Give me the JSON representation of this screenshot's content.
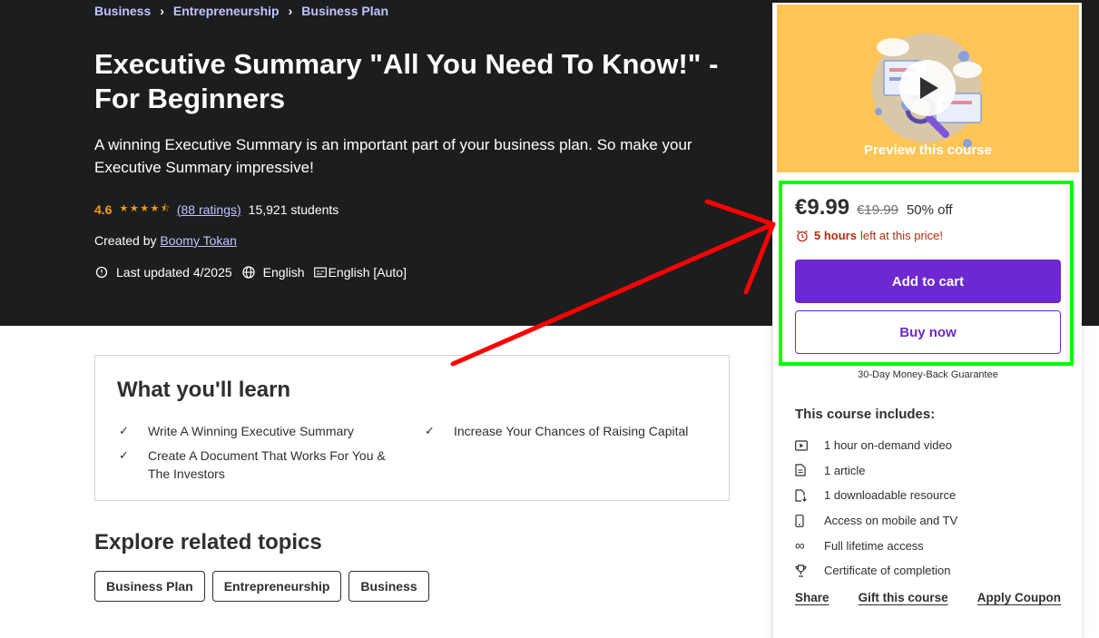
{
  "breadcrumb": [
    "Business",
    "Entrepreneurship",
    "Business Plan"
  ],
  "course": {
    "title": "Executive Summary \"All You Need To Know!\" - For Beginners",
    "subtitle": "A winning Executive Summary is an important part of your business plan. So make your Executive Summary impressive!",
    "rating": "4.6",
    "rating_value": 4.6,
    "ratings_count": "(88 ratings)",
    "students": "15,921 students",
    "created_by_label": "Created by",
    "instructor": "Boomy Tokan",
    "last_updated": "Last updated 4/2025",
    "language": "English",
    "captions": "English [Auto]"
  },
  "learn": {
    "title": "What you'll learn",
    "items": [
      "Write A Winning Executive Summary",
      "Increase Your Chances of Raising Capital",
      "Create A Document That Works For You & The Investors"
    ]
  },
  "related": {
    "title": "Explore related topics",
    "topics": [
      "Business Plan",
      "Entrepreneurship",
      "Business"
    ]
  },
  "card": {
    "preview_label": "Preview this course",
    "price": "€9.99",
    "old_price": "€19.99",
    "discount": "50% off",
    "timer_bold": "5 hours",
    "timer_rest": "left at this price!",
    "add_to_cart": "Add to cart",
    "buy_now": "Buy now",
    "guarantee": "30-Day Money-Back Guarantee",
    "includes_title": "This course includes:",
    "includes": [
      {
        "icon": "video-icon",
        "label": "1 hour on-demand video"
      },
      {
        "icon": "article-icon",
        "label": "1 article"
      },
      {
        "icon": "download-file-icon",
        "label": "1 downloadable resource"
      },
      {
        "icon": "mobile-icon",
        "label": "Access on mobile and TV"
      },
      {
        "icon": "infinity-icon",
        "label": "Full lifetime access"
      },
      {
        "icon": "trophy-icon",
        "label": "Certificate of completion"
      }
    ],
    "links": [
      "Share",
      "Gift this course",
      "Apply Coupon"
    ]
  },
  "colors": {
    "hero_bg": "#1c1d1f",
    "accent": "#6d28d2",
    "link": "#c0c4fc",
    "star": "#f69c08",
    "timer": "#b32d0f",
    "preview_bg": "#ffc557",
    "annotation_box": "#00ff00",
    "annotation_arrow": "#ff0000"
  }
}
